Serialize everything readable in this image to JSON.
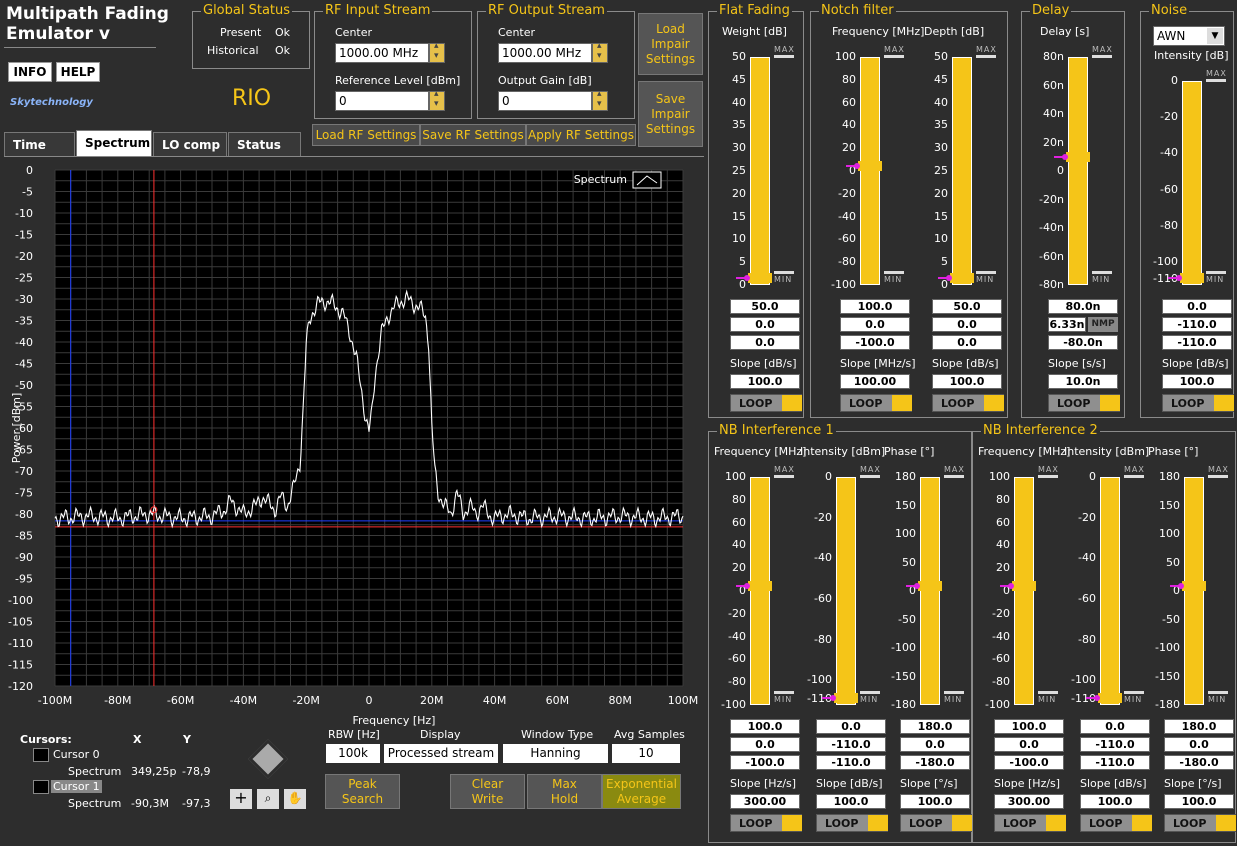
{
  "app": {
    "title_line1": "Multipath Fading",
    "title_line2": "Emulator v",
    "info": "INFO",
    "help": "HELP",
    "logo": "Skytechnology",
    "rio": "RIO"
  },
  "global_status": {
    "title": "Global Status",
    "present_label": "Present",
    "present_value": "Ok",
    "historical_label": "Historical",
    "historical_value": "Ok"
  },
  "rf_input": {
    "title": "RF Input Stream",
    "center_label": "Center",
    "center_value": "1000.00 MHz",
    "ref_label": "Reference Level [dBm]",
    "ref_value": "0"
  },
  "rf_output": {
    "title": "RF Output Stream",
    "center_label": "Center",
    "center_value": "1000.00 MHz",
    "gain_label": "Output Gain [dB]",
    "gain_value": "0"
  },
  "buttons": {
    "load_impair": "Load Impair Settings",
    "save_impair": "Save Impair Settings",
    "load_rf": "Load RF Settings",
    "save_rf": "Save RF Settings",
    "apply_rf": "Apply RF Settings",
    "peak_search": "Peak Search",
    "clear_write": "Clear Write",
    "max_hold": "Max Hold",
    "exp_avg": "Exponential Average",
    "loop": "LOOP"
  },
  "tabs": [
    "Time",
    "Spectrum",
    "LO comp",
    "Status"
  ],
  "chart_data": {
    "type": "line",
    "legend": "Spectrum",
    "xlabel": "Frequency [Hz]",
    "ylabel": "Power [dBm]",
    "xlim": [
      -100,
      100
    ],
    "ylim": [
      -120,
      0
    ],
    "x_ticks": [
      "-100M",
      "-80M",
      "-60M",
      "-40M",
      "-20M",
      "0",
      "20M",
      "40M",
      "60M",
      "80M",
      "100M"
    ],
    "y_ticks": [
      "0",
      "-5",
      "-10",
      "-15",
      "-20",
      "-25",
      "-30",
      "-35",
      "-40",
      "-45",
      "-50",
      "-55",
      "-60",
      "-65",
      "-70",
      "-75",
      "-80",
      "-85",
      "-90",
      "-95",
      "-100",
      "-105",
      "-110",
      "-115",
      "-120"
    ],
    "series": [
      {
        "name": "Spectrum",
        "x": [
          -100,
          -90,
          -80,
          -70,
          -60,
          -50,
          -46,
          -44,
          -40,
          -36,
          -34,
          -30,
          -28,
          -26,
          -24,
          -22,
          -21,
          -20,
          -19,
          -18,
          -16,
          -14,
          -12,
          -10,
          -8,
          -6,
          -4,
          -2,
          -1,
          0,
          1,
          2,
          4,
          6,
          8,
          10,
          12,
          14,
          16,
          18,
          19,
          20,
          21,
          22,
          24,
          26,
          28,
          30,
          32,
          34,
          36,
          38,
          40,
          44,
          48,
          50,
          60,
          70,
          80,
          90,
          100
        ],
        "y": [
          -81,
          -80.5,
          -81,
          -80,
          -81,
          -80.5,
          -79,
          -77,
          -80,
          -78,
          -76,
          -79,
          -76,
          -78,
          -74,
          -68,
          -56,
          -41,
          -35,
          -33,
          -31,
          -30.5,
          -31,
          -32,
          -34,
          -38,
          -44,
          -53,
          -58,
          -61,
          -56,
          -47,
          -38,
          -34,
          -32,
          -30.5,
          -30,
          -31,
          -32,
          -34,
          -40,
          -60,
          -70,
          -75,
          -78,
          -80,
          -75,
          -80,
          -78,
          -80,
          -78,
          -80,
          -81,
          -80,
          -80.5,
          -81,
          -80.5,
          -81,
          -80.5,
          -81,
          -80.5
        ]
      }
    ],
    "cursor0_x": -68.5,
    "cursor1_x": -95,
    "cursor_y": -83
  },
  "cursors": {
    "title": "Cursors:",
    "x_header": "X",
    "y_header": "Y",
    "c0": "Cursor 0",
    "c0_trace": "Spectrum",
    "c0_x": "349,25p",
    "c0_y": "-78,9",
    "c1": "Cursor 1",
    "c1_trace": "Spectrum",
    "c1_x": "-90,3M",
    "c1_y": "-97,3"
  },
  "rbw": {
    "label": "RBW [Hz]",
    "value": "100k"
  },
  "display": {
    "label": "Display",
    "value": "Processed stream"
  },
  "window": {
    "label": "Window Type",
    "value": "Hanning"
  },
  "avg": {
    "label": "Avg Samples",
    "value": "10"
  },
  "flat_fading": {
    "title": "Flat Fading",
    "weight_label": "Weight [dB]",
    "ticks": [
      "50",
      "45",
      "40",
      "35",
      "30",
      "25",
      "20",
      "15",
      "10",
      "5",
      "0"
    ],
    "v1": "50.0",
    "v2": "0.0",
    "v3": "0.0",
    "slope_label": "Slope [dB/s]",
    "slope": "100.0",
    "level": 0
  },
  "notch": {
    "title": "Notch filter",
    "freq_label": "Frequency [MHz]",
    "freq_ticks": [
      "100",
      "80",
      "60",
      "40",
      "20",
      "0",
      "-20",
      "-40",
      "-60",
      "-80",
      "-100"
    ],
    "f1": "100.0",
    "f2": "0.0",
    "f3": "-100.0",
    "f_slope_label": "Slope [MHz/s]",
    "f_slope": "100.00",
    "depth_label": "Depth [dB]",
    "depth_ticks": [
      "50",
      "45",
      "40",
      "35",
      "30",
      "25",
      "20",
      "15",
      "10",
      "5",
      "0"
    ],
    "d1": "50.0",
    "d2": "0.0",
    "d3": "0.0",
    "d_slope_label": "Slope [dB/s]",
    "d_slope": "100.0",
    "freq_level": 0.5,
    "depth_level": 0
  },
  "delay": {
    "title": "Delay",
    "label": "Delay [s]",
    "ticks": [
      "80n",
      "60n",
      "40n",
      "20n",
      "0",
      "-20n",
      "-40n",
      "-60n",
      "-80n"
    ],
    "v1": "80.0n",
    "v2": "6.33n",
    "nmp": "NMP",
    "v3": "-80.0n",
    "slope_label": "Slope [s/s]",
    "slope": "10.0n",
    "level": 0.54
  },
  "noise": {
    "title": "Noise",
    "type": "AWN",
    "label": "Intensity [dB]",
    "ticks": [
      "0",
      "-20",
      "-40",
      "-60",
      "-80",
      "-100",
      "-110"
    ],
    "v1": "0.0",
    "v2": "-110.0",
    "v3": "-110.0",
    "slope_label": "Slope [dB/s]",
    "slope": "100.0",
    "level": 0
  },
  "nb1": {
    "title": "NB Interference 1",
    "freq_label": "Frequency [MHz]",
    "freq_ticks": [
      "100",
      "80",
      "60",
      "40",
      "20",
      "0",
      "-20",
      "-40",
      "-60",
      "-80",
      "-100"
    ],
    "f1": "100.0",
    "f2": "0.0",
    "f3": "-100.0",
    "f_slope_label": "Slope [Hz/s]",
    "f_slope": "300.00",
    "int_label": "Intensity [dBm]",
    "int_ticks": [
      "0",
      "-20",
      "-40",
      "-60",
      "-80",
      "-100",
      "-110"
    ],
    "i1": "0.0",
    "i2": "-110.0",
    "i3": "-110.0",
    "i_slope_label": "Slope [dB/s]",
    "i_slope": "100.0",
    "ph_label": "Phase [°]",
    "ph_ticks": [
      "180",
      "150",
      "100",
      "50",
      "0",
      "-50",
      "-100",
      "-150",
      "-180"
    ],
    "p1": "180.0",
    "p2": "0.0",
    "p3": "-180.0",
    "p_slope_label": "Slope [°/s]",
    "p_slope": "100.0",
    "freq_level": 0.5,
    "int_level": 0,
    "ph_level": 0.5
  },
  "nb2": {
    "title": "NB Interference 2",
    "freq_label": "Frequency [MHz]",
    "freq_ticks": [
      "100",
      "80",
      "60",
      "40",
      "20",
      "0",
      "-20",
      "-40",
      "-60",
      "-80",
      "-100"
    ],
    "f1": "100.0",
    "f2": "0.0",
    "f3": "-100.0",
    "f_slope_label": "Slope [Hz/s]",
    "f_slope": "300.00",
    "int_label": "Intensity [dBm]",
    "int_ticks": [
      "0",
      "-20",
      "-40",
      "-60",
      "-80",
      "-100",
      "-110"
    ],
    "i1": "0.0",
    "i2": "-110.0",
    "i3": "-110.0",
    "i_slope_label": "Slope [dB/s]",
    "i_slope": "100.0",
    "ph_label": "Phase [°]",
    "ph_ticks": [
      "180",
      "150",
      "100",
      "50",
      "0",
      "-50",
      "-100",
      "-150",
      "-180"
    ],
    "p1": "180.0",
    "p2": "0.0",
    "p3": "-180.0",
    "p_slope_label": "Slope [°/s]",
    "p_slope": "100.0",
    "freq_level": 0.5,
    "int_level": 0,
    "ph_level": 0.5
  },
  "slider_labels": {
    "max": "MAX",
    "min": "MIN"
  }
}
